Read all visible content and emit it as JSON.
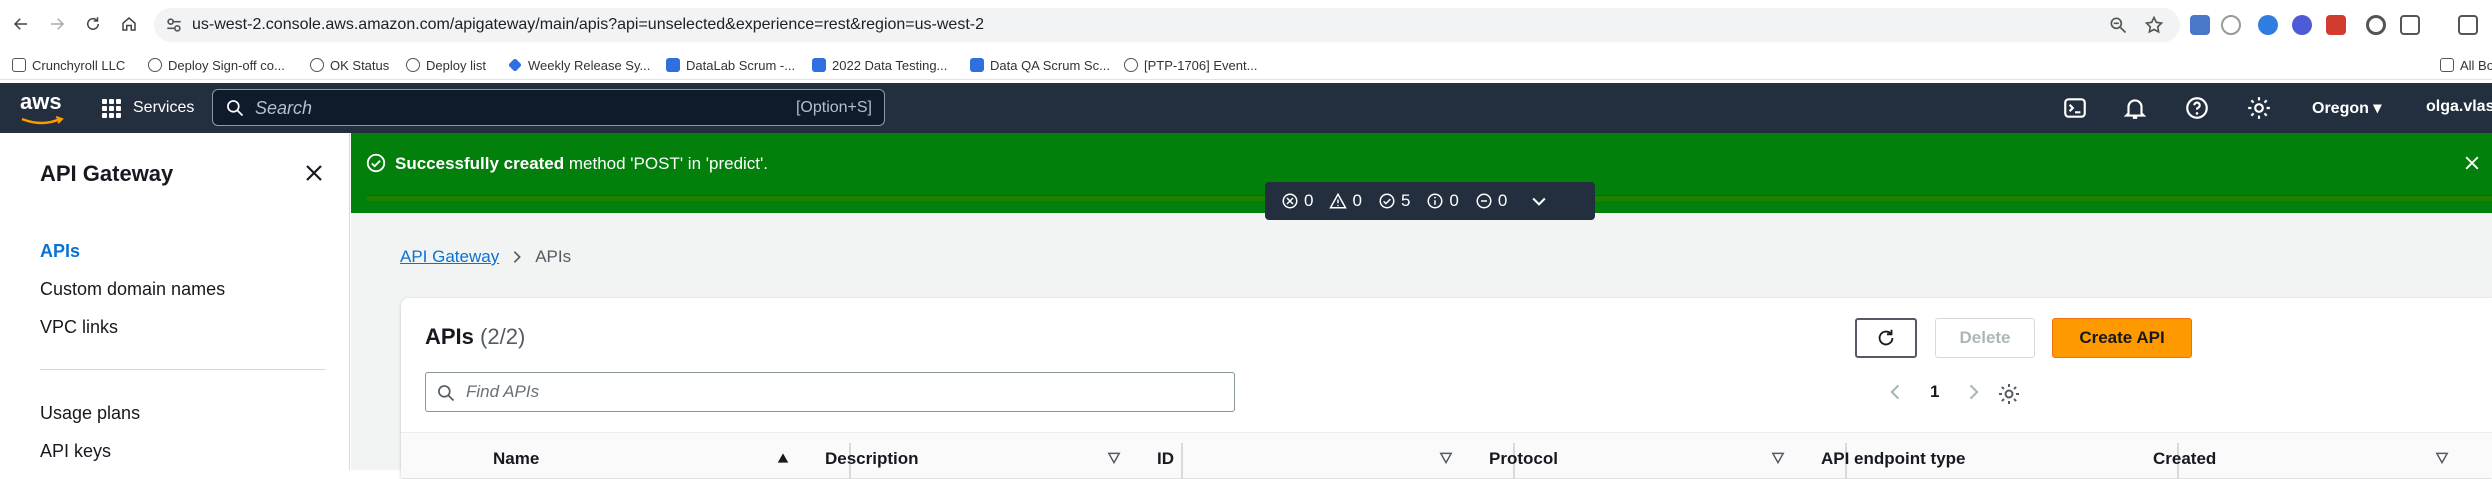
{
  "browser": {
    "url": "us-west-2.console.aws.amazon.com/apigateway/main/apis?api=unselected&experience=rest&region=us-west-2",
    "bookmarks": [
      "Crunchyroll LLC",
      "Deploy Sign-off co...",
      "OK Status",
      "Deploy list",
      "Weekly Release Sy...",
      "DataLab Scrum -...",
      "2022 Data Testing...",
      "Data QA Scrum Sc...",
      "[PTP-1706] Event...",
      "All Bo"
    ]
  },
  "aws_nav": {
    "logo_text": "aws",
    "services_label": "Services",
    "search_placeholder": "Search",
    "search_shortcut": "[Option+S]",
    "region": "Oregon",
    "user": "olga.vlase"
  },
  "sidebar": {
    "title": "API Gateway",
    "items": [
      {
        "label": "APIs"
      },
      {
        "label": "Custom domain names"
      },
      {
        "label": "VPC links"
      },
      {
        "label": "Usage plans"
      },
      {
        "label": "API keys"
      }
    ]
  },
  "flash": {
    "bold_text": "Successfully created",
    "text": " method 'POST' in 'predict'."
  },
  "status_bar": {
    "errors": "0",
    "warnings": "0",
    "success": "5",
    "info": "0",
    "pending": "0"
  },
  "breadcrumb": {
    "root": "API Gateway",
    "current": "APIs"
  },
  "panel": {
    "title": "APIs",
    "count": "(2/2)",
    "delete_label": "Delete",
    "create_label": "Create API",
    "find_placeholder": "Find APIs",
    "page_number": "1",
    "columns": [
      "Name",
      "Description",
      "ID",
      "Protocol",
      "API endpoint type",
      "Created"
    ]
  },
  "colors": {
    "aws_nav": "#232f3e",
    "success": "#037f0c",
    "link": "#0972d3",
    "primary_button": "#ff9900"
  }
}
